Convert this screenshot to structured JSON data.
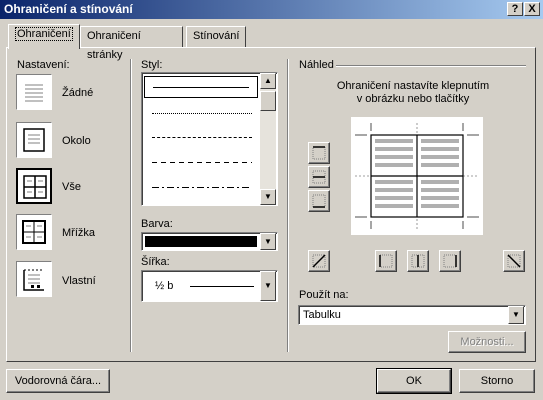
{
  "window": {
    "title": "Ohraničení a stínování",
    "help_btn": "?",
    "close_btn": "X"
  },
  "tabs": [
    {
      "label": "Ohraničení",
      "active": true
    },
    {
      "label": "Ohraničení stránky",
      "active": false
    },
    {
      "label": "Stínování",
      "active": false
    }
  ],
  "settings": {
    "label": "Nastavení:",
    "items": [
      {
        "label": "Žádné"
      },
      {
        "label": "Okolo"
      },
      {
        "label": "Vše",
        "selected": true
      },
      {
        "label": "Mřížka"
      },
      {
        "label": "Vlastní"
      }
    ]
  },
  "style": {
    "label": "Styl:"
  },
  "color": {
    "label": "Barva:",
    "value_color": "#000000"
  },
  "width": {
    "label": "Šířka:",
    "value": "½ b"
  },
  "preview": {
    "label": "Náhled",
    "hint_line1": "Ohraničení nastavíte klepnutím",
    "hint_line2": "v obrázku nebo tlačítky"
  },
  "apply_to": {
    "label": "Použít na:",
    "value": "Tabulku"
  },
  "buttons": {
    "options": "Možnosti...",
    "horizontal_line": "Vodorovná čára...",
    "ok": "OK",
    "cancel": "Storno"
  }
}
